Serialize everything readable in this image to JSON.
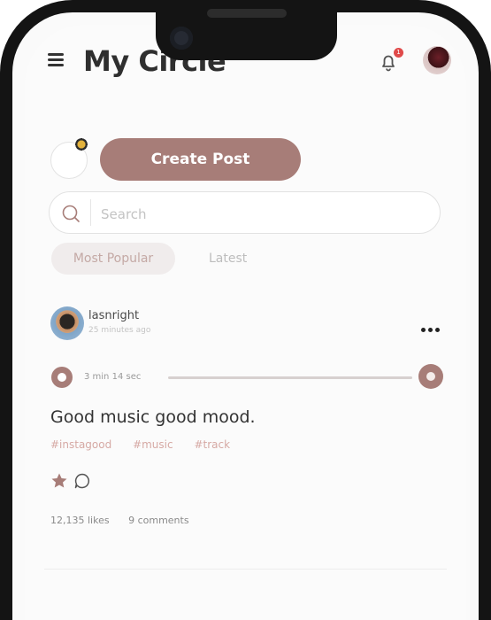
{
  "header": {
    "title": "My Circle",
    "notification_count": "1",
    "menu_icon": "hamburger-icon",
    "bell_icon": "bell-icon"
  },
  "composer": {
    "create_post_label": "Create Post"
  },
  "search": {
    "placeholder": "Search",
    "value": ""
  },
  "tabs": [
    {
      "label": "Most Popular",
      "active": true
    },
    {
      "label": "Latest",
      "active": false
    }
  ],
  "post": {
    "username": "lasnright",
    "time": "25 minutes ago",
    "audio_duration": "3 min 14 sec",
    "audio_progress": 0.0,
    "text": "Good music good mood.",
    "hashtags": [
      "#instagood",
      "#music",
      "#track"
    ],
    "likes": "12,135 likes",
    "comments": "9 comments"
  },
  "colors": {
    "accent": "#a77d78",
    "hashtag": "#d6a9a4",
    "badge": "#e04a4a"
  }
}
